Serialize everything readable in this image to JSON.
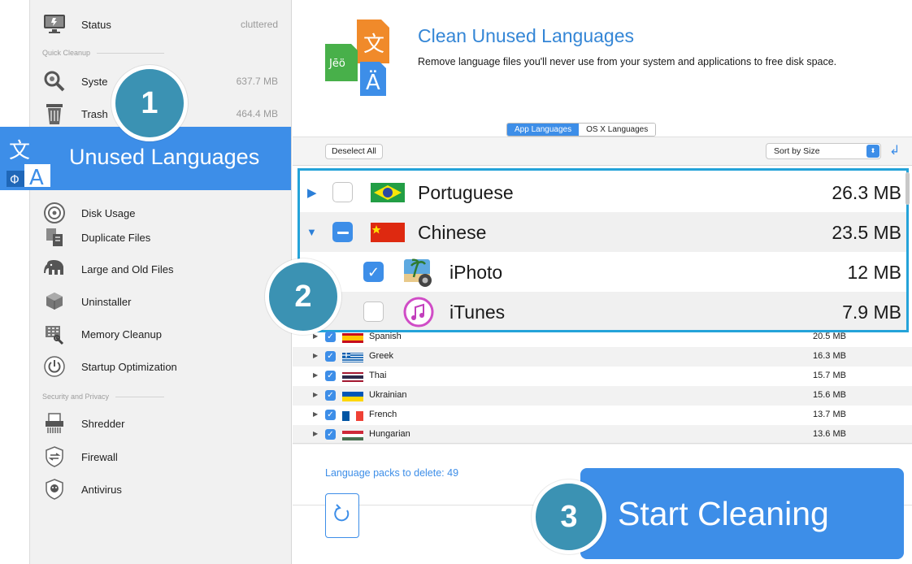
{
  "sidebar": {
    "status": {
      "label": "Status",
      "value": "cluttered"
    },
    "quick_cleanup_header": "Quick Cleanup",
    "system": {
      "label": "Syste",
      "value": "637.7 MB"
    },
    "trash": {
      "label": "Trash",
      "value": "464.4 MB"
    },
    "selected": {
      "label": "Unused Languages"
    },
    "items": [
      {
        "label": "Disk Usage",
        "icon": "disk-usage-icon"
      },
      {
        "label": "Duplicate Files",
        "icon": "duplicate-files-icon"
      },
      {
        "label": "Large and Old Files",
        "icon": "elephant-icon"
      },
      {
        "label": "Uninstaller",
        "icon": "uninstaller-icon"
      },
      {
        "label": "Memory Cleanup",
        "icon": "memory-icon"
      },
      {
        "label": "Startup Optimization",
        "icon": "power-icon"
      }
    ],
    "security_header": "Security and Privacy",
    "security_items": [
      {
        "label": "Shredder",
        "icon": "shredder-icon"
      },
      {
        "label": "Firewall",
        "icon": "firewall-icon"
      },
      {
        "label": "Antivirus",
        "icon": "antivirus-icon"
      }
    ]
  },
  "callouts": {
    "one": "1",
    "two": "2",
    "three": "3"
  },
  "header": {
    "title": "Clean Unused Languages",
    "description": "Remove language files you'll never use from your system and applications to free disk space."
  },
  "tabs": [
    {
      "label": "App Languages",
      "active": true
    },
    {
      "label": "OS X Languages",
      "active": false
    }
  ],
  "toolbar": {
    "deselect_label": "Deselect All",
    "sort_label": "Sort by Size"
  },
  "zoomed_list": [
    {
      "label": "Portuguese",
      "size": "26.3 MB",
      "state": "unchecked",
      "expanded": false
    },
    {
      "label": "Chinese",
      "size": "23.5 MB",
      "state": "mixed",
      "expanded": true
    },
    {
      "label": "iPhoto",
      "size": "12 MB",
      "state": "checked",
      "child": true
    },
    {
      "label": "iTunes",
      "size": "7.9 MB",
      "state": "unchecked",
      "child": true
    }
  ],
  "languages": [
    {
      "label": "Spanish",
      "size": "20.5 MB"
    },
    {
      "label": "Greek",
      "size": "16.3 MB"
    },
    {
      "label": "Thai",
      "size": "15.7 MB"
    },
    {
      "label": "Ukrainian",
      "size": "15.6 MB"
    },
    {
      "label": "French",
      "size": "13.7 MB"
    },
    {
      "label": "Hungarian",
      "size": "13.6 MB"
    }
  ],
  "footer": {
    "packs_label": "Language packs to delete: 49",
    "start_label": "Start Cleaning"
  },
  "colors": {
    "accent": "#3d8ee8",
    "callout": "#3b92b3",
    "highlight_border": "#24a3d9"
  }
}
